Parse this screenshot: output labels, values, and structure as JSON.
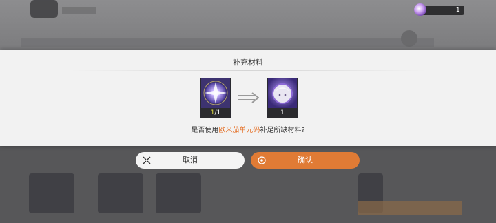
{
  "currency": {
    "icon": "purple-gem-icon",
    "value": "1"
  },
  "dialog": {
    "title": "补充材料",
    "from_item": {
      "icon": "purple-crystal-material-icon",
      "have": "1",
      "need": "/1"
    },
    "to_item": {
      "icon": "character-rune-portrait-icon",
      "count": "1"
    },
    "question_pre": "是否使用",
    "question_highlight": "欧米茄单元码",
    "question_post": "补足所缺材料?"
  },
  "buttons": {
    "cancel_label": "取消",
    "confirm_label": "确认"
  },
  "colors": {
    "accent": "#e07b35",
    "highlight_text": "#e5732b",
    "count_have": "#e7e442",
    "item_bg": "#3b2f6b"
  }
}
